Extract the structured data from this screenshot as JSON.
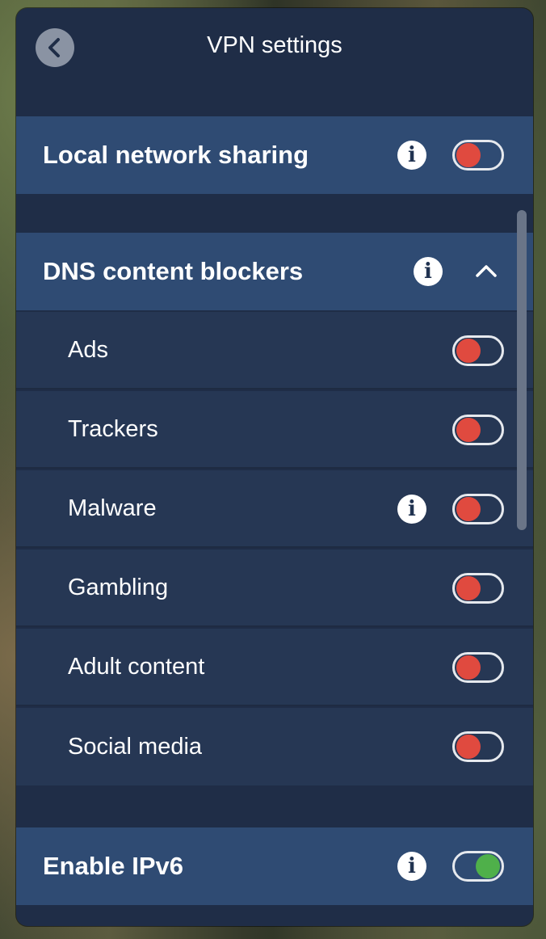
{
  "window": {
    "title": "VPN settings",
    "back_icon": "chevron-left-icon"
  },
  "local_network_sharing": {
    "label": "Local network sharing",
    "info_icon": "info-icon",
    "enabled": false
  },
  "dns_content_blockers": {
    "label": "DNS content blockers",
    "info_icon": "info-icon",
    "expanded": true,
    "items": [
      {
        "label": "Ads",
        "enabled": false,
        "has_info": false
      },
      {
        "label": "Trackers",
        "enabled": false,
        "has_info": false
      },
      {
        "label": "Malware",
        "enabled": false,
        "has_info": true
      },
      {
        "label": "Gambling",
        "enabled": false,
        "has_info": false
      },
      {
        "label": "Adult content",
        "enabled": false,
        "has_info": false
      },
      {
        "label": "Social media",
        "enabled": false,
        "has_info": false
      }
    ]
  },
  "enable_ipv6": {
    "label": "Enable IPv6",
    "info_icon": "info-icon",
    "enabled": true
  },
  "colors": {
    "window_bg": "#1f2d47",
    "header_row_bg": "#2f4b73",
    "sub_row_bg": "#263754",
    "toggle_off": "#e04a3f",
    "toggle_on": "#4fb04a"
  }
}
